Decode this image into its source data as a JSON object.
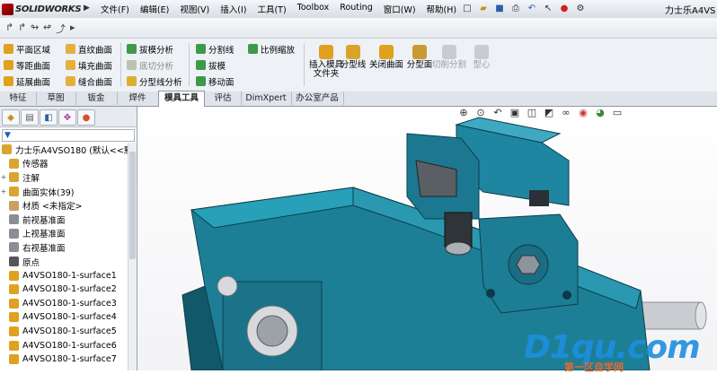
{
  "app": {
    "logo_text": "SOLIDWORKS",
    "title": "力士乐A4VS"
  },
  "menu": [
    "文件(F)",
    "编辑(E)",
    "视图(V)",
    "插入(I)",
    "工具(T)",
    "Toolbox",
    "Routing",
    "窗口(W)",
    "帮助(H)"
  ],
  "ribbon": {
    "col1": [
      "平面区域",
      "等距曲面",
      "延展曲面"
    ],
    "col2": [
      "直纹曲面",
      "填充曲面",
      "缝合曲面"
    ],
    "col3": [
      "拔模分析",
      "底切分析",
      "分型线分析"
    ],
    "col4": [
      "分割线",
      "拔模",
      "移动面"
    ],
    "col5": [
      "比例缩放"
    ],
    "big": [
      {
        "label": "插入模具文件夹",
        "enabled": true
      },
      {
        "label": "分型线",
        "enabled": true
      },
      {
        "label": "关闭曲面",
        "enabled": true
      },
      {
        "label": "分型面",
        "enabled": true
      },
      {
        "label": "切削分割",
        "enabled": false
      },
      {
        "label": "型心",
        "enabled": false
      }
    ]
  },
  "tabs": [
    "特征",
    "草图",
    "钣金",
    "焊件",
    "模具工具",
    "评估",
    "DimXpert",
    "办公室产品"
  ],
  "active_tab": "模具工具",
  "tree": {
    "root": "力士乐A4VSO180 (默认<<默",
    "items": [
      {
        "label": "传感器",
        "expand": ""
      },
      {
        "label": "注解",
        "expand": "+"
      },
      {
        "label": "曲面实体(39)",
        "expand": "+"
      },
      {
        "label": "材质 <未指定>",
        "expand": ""
      },
      {
        "label": "前视基准面",
        "expand": ""
      },
      {
        "label": "上视基准面",
        "expand": ""
      },
      {
        "label": "右视基准面",
        "expand": ""
      },
      {
        "label": "原点",
        "expand": ""
      },
      {
        "label": "A4VSO180-1-surface1",
        "expand": ""
      },
      {
        "label": "A4VSO180-1-surface2",
        "expand": ""
      },
      {
        "label": "A4VSO180-1-surface3",
        "expand": ""
      },
      {
        "label": "A4VSO180-1-surface4",
        "expand": ""
      },
      {
        "label": "A4VSO180-1-surface5",
        "expand": ""
      },
      {
        "label": "A4VSO180-1-surface6",
        "expand": ""
      },
      {
        "label": "A4VSO180-1-surface7",
        "expand": ""
      }
    ]
  },
  "watermark": {
    "main": "D1qu.com",
    "sub": "第一区自学网"
  },
  "colors": {
    "model_teal": "#1c7d94",
    "model_dark": "#134f60",
    "accent": "#1e8fe0"
  }
}
